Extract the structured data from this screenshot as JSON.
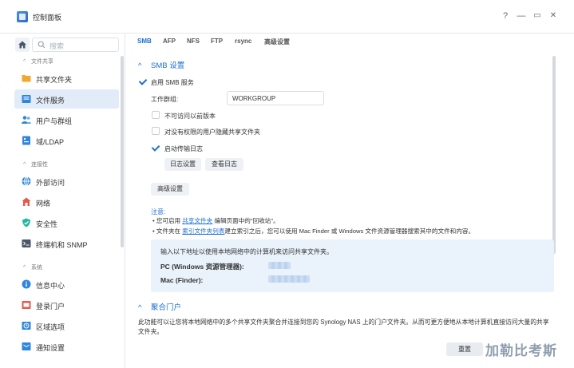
{
  "window": {
    "title": "控制面板",
    "help": "?",
    "minimize": "—",
    "maximize": "▭",
    "close": "✕"
  },
  "sidebar": {
    "search_placeholder": "搜索",
    "groups": [
      {
        "title": "文件共享",
        "items": [
          "共享文件夹",
          "文件服务"
        ]
      },
      {
        "extra": [
          "用户与群组",
          "域/LDAP"
        ]
      },
      {
        "title": "连接性",
        "items": [
          "外部访问",
          "网络",
          "安全性",
          "终端机和 SNMP"
        ]
      },
      {
        "title": "系统",
        "items": [
          "信息中心",
          "登录门户",
          "区域选项",
          "通知设置"
        ]
      }
    ],
    "active": "文件服务"
  },
  "tabs": [
    "SMB",
    "AFP",
    "NFS",
    "FTP",
    "rsync",
    "高级设置"
  ],
  "smb": {
    "section_title": "SMB 设置",
    "enable_label": "启用 SMB 服务",
    "workgroup_label": "工作群组:",
    "workgroup_value": "WORKGROUP",
    "opt1": "不可访问以前版本",
    "opt2": "对没有权限的用户隐藏共享文件夹",
    "opt3": "启动传输日志",
    "log_settings": "日志设置",
    "view_log": "查看日志",
    "advanced": "高级设置",
    "note_title": "注意:",
    "note1_pre": "您可启用 ",
    "note1_link": "共享文件夹",
    "note1_post": " 编辑页面中的\"回收站\"。",
    "note2_pre": "文件夹在 ",
    "note2_link": "索引文件夹列表",
    "note2_post": "建立索引之后，您可以使用 Mac Finder 或 Windows 文件资源管理器搜索其中的文件和内容。",
    "info_line": "输入以下地址以使用本地网络中的计算机来访问共享文件夹。",
    "pc_label": "PC (Windows 资源管理器):",
    "mac_label": "Mac (Finder):"
  },
  "portal": {
    "section_title": "聚合门户",
    "desc": "此功能可以让您将本地网络中的多个共享文件夹聚合并连接到您的 Synology NAS 上的门户文件夹。从而可更方便地从本地计算机直接访问大量的共享文件夹。"
  },
  "footer": {
    "reset": "重置"
  },
  "watermark": "加勒比考斯"
}
